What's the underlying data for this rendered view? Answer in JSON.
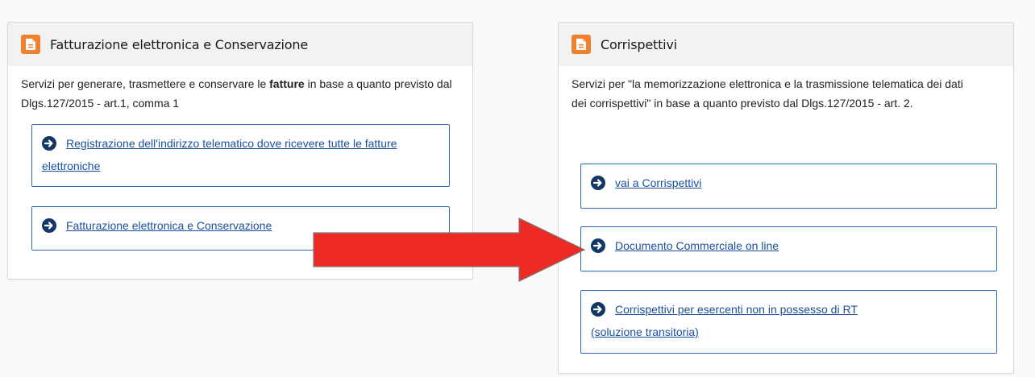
{
  "left_panel": {
    "title": "Fatturazione elettronica e Conservazione",
    "desc_pre": "Servizi per generare, trasmettere e conservare le ",
    "desc_bold": "fatture",
    "desc_post": " in base a quanto previsto dal Dlgs.127/2015 - art.1, comma 1",
    "links": [
      "Registrazione dell'indirizzo telematico dove ricevere tutte le fatture elettroniche",
      "Fatturazione elettronica e Conservazione"
    ]
  },
  "right_panel": {
    "title": "Corrispettivi",
    "desc": "Servizi per \"la memorizzazione elettronica e la trasmissione telematica dei dati dei corrispettivi\" in base a quanto previsto dal Dlgs.127/2015 - art. 2.",
    "links": [
      "vai a Corrispettivi",
      "Documento Commerciale on line",
      "Corrispettivi per esercenti non in possesso di RT (soluzione transitoria)"
    ]
  },
  "colors": {
    "icon_orange": "#f0822e",
    "link_blue": "#1a4f9c",
    "border_blue": "#2d6ab8",
    "annotation_red": "#ee2a24"
  },
  "icons": {
    "panel_icon": "document-icon",
    "link_icon": "circle-arrow-right-icon",
    "annotation": "red-arrow-annotation"
  }
}
